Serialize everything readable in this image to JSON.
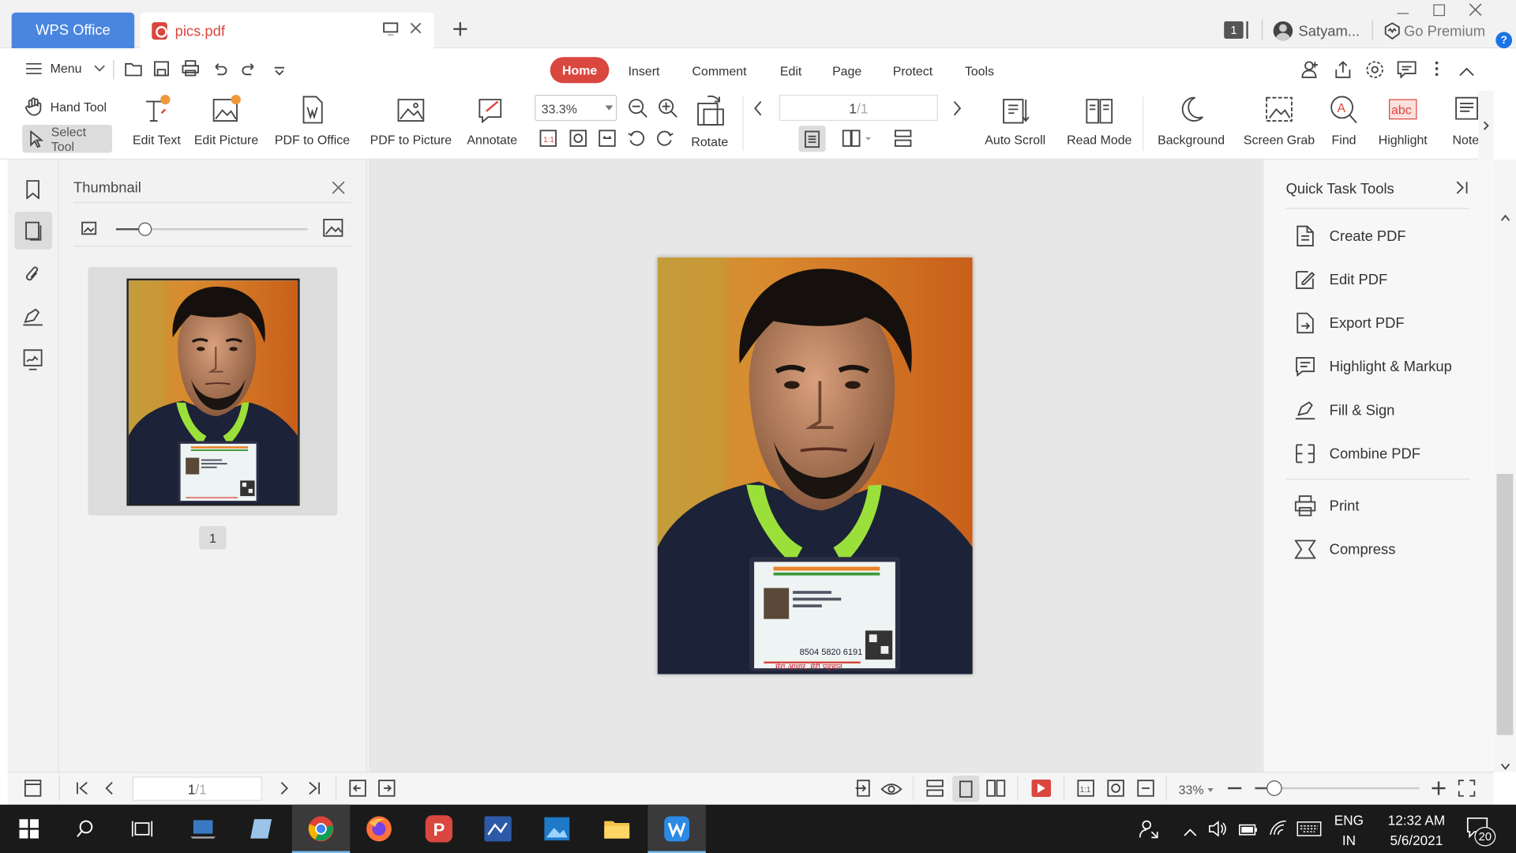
{
  "tabs": {
    "app_label": "WPS Office",
    "file_label": "pics.pdf"
  },
  "titlebar": {
    "window_count": "1",
    "user": "Satyam...",
    "premium": "Go Premium"
  },
  "menu": {
    "label": "Menu"
  },
  "nav_tabs": [
    "Home",
    "Insert",
    "Comment",
    "Edit",
    "Page",
    "Protect",
    "Tools"
  ],
  "ribbon": {
    "hand_tool": "Hand Tool",
    "select_tool": "Select Tool",
    "edit_text": "Edit Text",
    "edit_picture": "Edit Picture",
    "pdf_to_office": "PDF to Office",
    "pdf_to_picture": "PDF to Picture",
    "annotate": "Annotate",
    "zoom_value": "33.3%",
    "rotate": "Rotate",
    "page_current": "1",
    "page_total": "/1",
    "auto_scroll": "Auto Scroll",
    "read_mode": "Read Mode",
    "background": "Background",
    "screen_grab": "Screen Grab",
    "find": "Find",
    "highlight": "Highlight",
    "note": "Note"
  },
  "thumbnail_panel": {
    "title": "Thumbnail",
    "page_label": "1",
    "zoom_level": 0.15
  },
  "quick_tasks": {
    "title": "Quick Task Tools",
    "items": [
      "Create PDF",
      "Edit PDF",
      "Export PDF",
      "Highlight & Markup",
      "Fill & Sign",
      "Combine PDF"
    ],
    "items2": [
      "Print",
      "Compress"
    ]
  },
  "id_card": {
    "number": "8504 5820 6191",
    "tagline": "मेरा आधार, मेरी पहचान"
  },
  "statusbar": {
    "page_current": "1",
    "page_total": "/1",
    "zoom": "33%",
    "zoom_level": 0.12
  },
  "taskbar": {
    "lang1": "ENG",
    "lang2": "IN",
    "time": "12:32 AM",
    "date": "5/6/2021",
    "notifications": "20"
  },
  "colors": {
    "accent_red": "#d9473f",
    "wps_blue": "#4a86e0",
    "taskbar": "#1a1a1a"
  }
}
